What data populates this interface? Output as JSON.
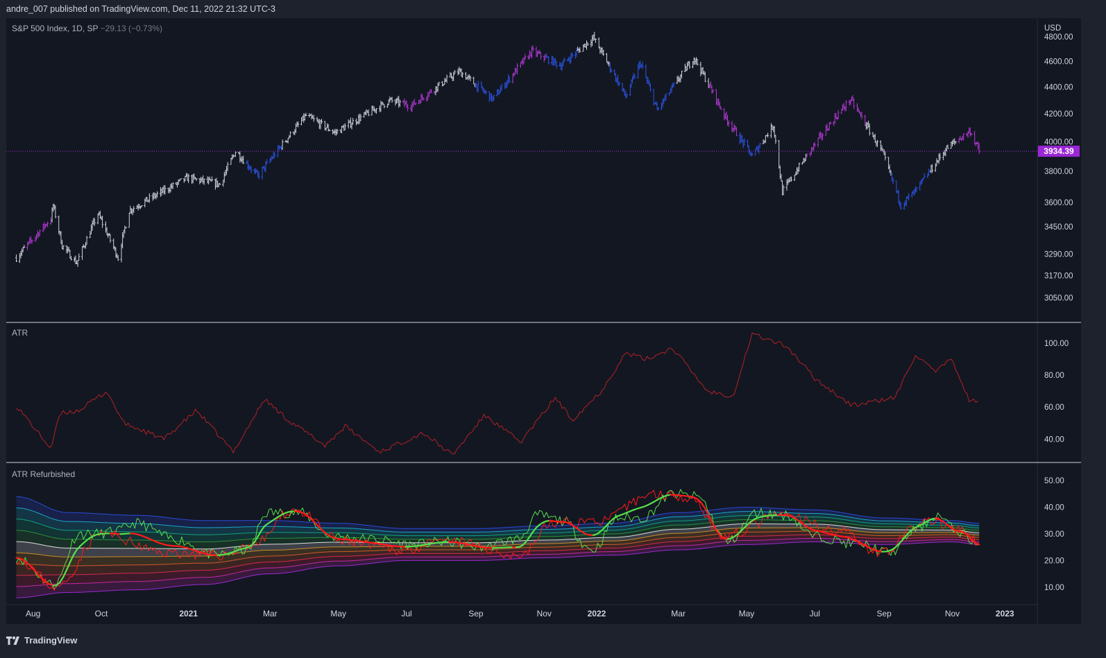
{
  "header": {
    "publisher": "andre_007 published on TradingView.com, Dec 11, 2022 21:32 UTC-3"
  },
  "footer": {
    "brand": "TradingView",
    "logo_icon": "tradingview-logo-icon"
  },
  "colors": {
    "bg": "#131722",
    "up": "#d1d4dc",
    "magenta": "#b33ad6",
    "blue": "#2b55e8",
    "atr": "#b22222",
    "fast": "#56e04a",
    "slow": "#ff1a1a",
    "price_line": "#9b30d9"
  },
  "chart_data": [
    {
      "type": "ohlc",
      "title": "S&P 500 Index, 1D, SP",
      "change": "−29.13 (−0.73%)",
      "currency": "USD",
      "last_price": "3934.39",
      "y_ticks": [
        "4800.00",
        "4600.00",
        "4400.00",
        "4200.00",
        "4000.00",
        "3800.00",
        "3600.00",
        "3450.00",
        "3290.00",
        "3170.00",
        "3050.00"
      ],
      "ylim": [
        2950,
        4900
      ],
      "x": [
        "2020-07-31",
        "2020-08-15",
        "2020-08-31",
        "2020-09-02",
        "2020-09-10",
        "2020-09-23",
        "2020-10-12",
        "2020-10-30",
        "2020-11-09",
        "2020-12-31",
        "2021-01-29",
        "2021-02-12",
        "2021-03-04",
        "2021-04-16",
        "2021-05-12",
        "2021-06-30",
        "2021-07-19",
        "2021-08-31",
        "2021-09-30",
        "2021-11-04",
        "2021-11-30",
        "2021-12-29",
        "2022-01-27",
        "2022-02-09",
        "2022-02-24",
        "2022-03-29",
        "2022-04-26",
        "2022-05-20",
        "2022-06-08",
        "2022-06-16",
        "2022-07-29",
        "2022-08-16",
        "2022-09-13",
        "2022-09-30",
        "2022-10-13",
        "2022-11-10",
        "2022-12-01",
        "2022-12-09"
      ],
      "close": [
        3270,
        3380,
        3500,
        3580,
        3340,
        3240,
        3530,
        3270,
        3550,
        3756,
        3714,
        3934,
        3768,
        4185,
        4063,
        4297,
        4258,
        4522,
        4307,
        4680,
        4567,
        4793,
        4326,
        4587,
        4225,
        4631,
        4175,
        3901,
        4115,
        3666,
        4130,
        4305,
        3932,
        3585,
        3669,
        3956,
        4076,
        3934
      ],
      "colors": [
        "w",
        "m",
        "m",
        "w",
        "w",
        "w",
        "w",
        "w",
        "w",
        "w",
        "w",
        "w",
        "b",
        "w",
        "w",
        "w",
        "m",
        "w",
        "b",
        "m",
        "b",
        "w",
        "b",
        "b",
        "b",
        "w",
        "m",
        "b",
        "w",
        "w",
        "m",
        "m",
        "w",
        "b",
        "b",
        "w",
        "m",
        "m"
      ],
      "price_line": 3934.39
    },
    {
      "type": "line",
      "title": "ATR",
      "y_ticks": [
        "100.00",
        "80.00",
        "60.00",
        "40.00"
      ],
      "ylim": [
        28,
        110
      ],
      "x": [
        "2020-07-31",
        "2020-08-31",
        "2020-09-08",
        "2020-09-25",
        "2020-10-20",
        "2020-11-04",
        "2020-12-10",
        "2021-01-08",
        "2021-02-10",
        "2021-03-10",
        "2021-03-31",
        "2021-05-03",
        "2021-05-21",
        "2021-06-21",
        "2021-07-30",
        "2021-08-25",
        "2021-09-23",
        "2021-10-25",
        "2021-11-25",
        "2021-12-10",
        "2022-01-05",
        "2022-01-27",
        "2022-02-14",
        "2022-03-10",
        "2022-04-10",
        "2022-05-03",
        "2022-05-20",
        "2022-06-20",
        "2022-07-15",
        "2022-08-17",
        "2022-09-25",
        "2022-10-13",
        "2022-10-30",
        "2022-11-15",
        "2022-11-30",
        "2022-12-09"
      ],
      "values": [
        61,
        34,
        56,
        58,
        70,
        50,
        40,
        58,
        32,
        65,
        52,
        36,
        48,
        32,
        44,
        30,
        55,
        38,
        66,
        52,
        70,
        94,
        90,
        97,
        70,
        67,
        106,
        98,
        78,
        61,
        66,
        93,
        82,
        90,
        64,
        64
      ],
      "color": "#b22222"
    },
    {
      "type": "line-bands",
      "title": "ATR Refurbished",
      "y_ticks": [
        "50.00",
        "40.00",
        "30.00",
        "20.00",
        "10.00"
      ],
      "ylim": [
        5,
        55
      ],
      "x_ticks": [
        "Aug",
        "Oct",
        "2021",
        "Mar",
        "May",
        "Jul",
        "Sep",
        "Nov",
        "2022",
        "Mar",
        "May",
        "Jul",
        "Sep",
        "Nov",
        "2023"
      ],
      "band_x": [
        "2020-07-31",
        "2020-09-15",
        "2020-11-15",
        "2021-01-15",
        "2021-03-15",
        "2021-05-15",
        "2021-07-15",
        "2021-09-15",
        "2021-11-15",
        "2022-01-15",
        "2022-03-15",
        "2022-05-15",
        "2022-07-15",
        "2022-09-15",
        "2022-11-15",
        "2022-12-09"
      ],
      "band_center": [
        25,
        23,
        23,
        23,
        25,
        26,
        26,
        26,
        27,
        28,
        31,
        33,
        33,
        31,
        31,
        30
      ],
      "band_half": [
        19,
        15,
        14,
        12,
        10,
        8,
        6,
        6,
        6,
        6,
        7,
        7,
        6,
        5,
        4,
        4
      ],
      "band_colors": [
        "#2b4bd6",
        "#1aa6c5",
        "#13a07c",
        "#2e8f3a",
        "#dcdcdc",
        "#c98a2a",
        "#cc5a2a",
        "#d22a4a",
        "#c02aa0",
        "#9a2ad0"
      ],
      "fast_x": [
        "2020-07-31",
        "2020-09-03",
        "2020-09-25",
        "2020-10-12",
        "2020-10-28",
        "2020-11-15",
        "2020-12-20",
        "2021-01-25",
        "2021-02-23",
        "2021-03-12",
        "2021-04-10",
        "2021-05-10",
        "2021-06-15",
        "2021-07-20",
        "2021-08-20",
        "2021-09-20",
        "2021-10-22",
        "2021-11-10",
        "2021-12-01",
        "2021-12-28",
        "2022-01-20",
        "2022-02-10",
        "2022-03-10",
        "2022-04-01",
        "2022-04-28",
        "2022-05-25",
        "2022-06-20",
        "2022-07-15",
        "2022-08-25",
        "2022-09-20",
        "2022-10-15",
        "2022-11-01",
        "2022-11-20",
        "2022-12-09"
      ],
      "fast": [
        21,
        11,
        30,
        30,
        31,
        34,
        28,
        22,
        24,
        38,
        38,
        29,
        28,
        26,
        27,
        25,
        28,
        37,
        35,
        24,
        36,
        36,
        45,
        44,
        27,
        38,
        37,
        29,
        26,
        23,
        32,
        37,
        31,
        26
      ],
      "slow_x": [
        "2020-07-31",
        "2020-09-05",
        "2020-10-15",
        "2020-12-10",
        "2021-01-30",
        "2021-02-28",
        "2021-04-05",
        "2021-05-20",
        "2021-07-05",
        "2021-08-25",
        "2021-10-25",
        "2021-11-22",
        "2022-01-05",
        "2022-02-20",
        "2022-03-25",
        "2022-04-25",
        "2022-06-15",
        "2022-08-10",
        "2022-09-10",
        "2022-10-25",
        "2022-11-25",
        "2022-12-09"
      ],
      "slow": [
        21,
        10,
        30,
        23,
        22,
        26,
        39,
        27,
        24,
        27,
        22,
        34,
        35,
        45,
        44,
        29,
        37,
        31,
        23,
        35,
        31,
        26
      ]
    }
  ]
}
